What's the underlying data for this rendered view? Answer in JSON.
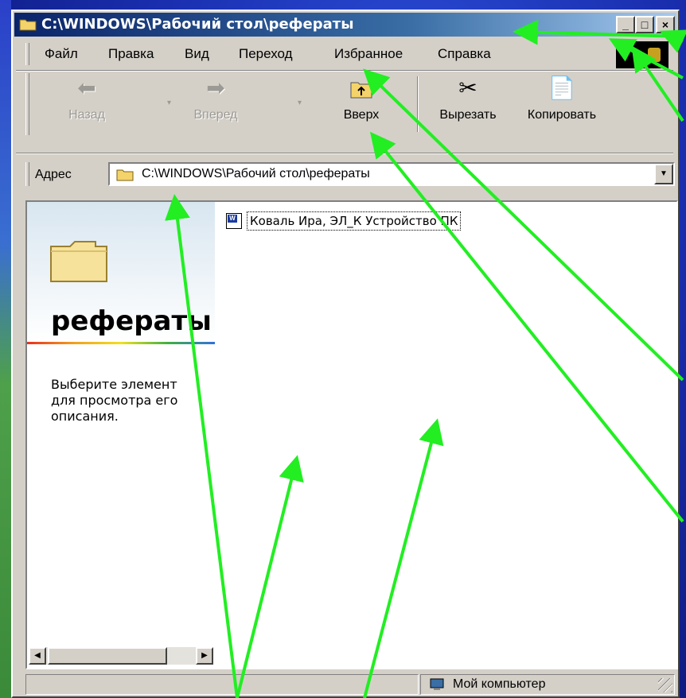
{
  "window": {
    "title": "C:\\WINDOWS\\Рабочий стол\\рефераты",
    "controls": {
      "minimize": "_",
      "maximize": "□",
      "close": "×"
    }
  },
  "menu": {
    "items": [
      "Файл",
      "Правка",
      "Вид",
      "Переход",
      "Избранное",
      "Справка"
    ]
  },
  "toolbar": {
    "back_label": "Назад",
    "forward_label": "Вперед",
    "up_label": "Вверх",
    "cut_label": "Вырезать",
    "copy_label": "Копировать"
  },
  "address": {
    "label": "Адрес",
    "value": "C:\\WINDOWS\\Рабочий стол\\рефераты"
  },
  "left_pane": {
    "folder_title": "рефераты",
    "description": "Выберите элемент для просмотра его описания."
  },
  "files": [
    {
      "name": "Коваль Ира, ЭЛ_К Устройство ПК",
      "icon": "word-document-icon"
    }
  ],
  "status": {
    "zone": "Мой компьютер"
  },
  "colors": {
    "title_bar_start": "#0a246a",
    "title_bar_end": "#a6caf0",
    "annotation_arrow": "#22ee22",
    "window_face": "#d4d0c8"
  }
}
